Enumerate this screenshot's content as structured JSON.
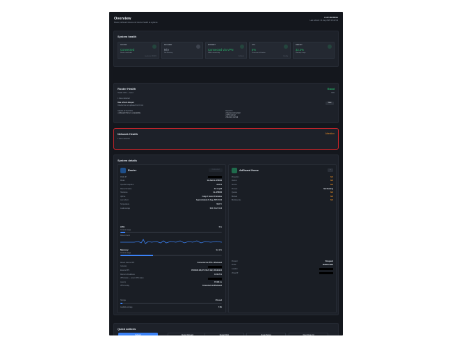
{
  "header": {
    "title": "Overview",
    "subtitle": "Router, AdGuard Home and internet health at a glance",
    "refresh_label": "LAST REFRESH",
    "refresh_time": "Last refresh: 21 Aug 2025 15:22:43"
  },
  "system_health": {
    "title": "System health",
    "tiles": [
      {
        "label": "ROUTER",
        "value": "Connected",
        "note": "Router reachable",
        "foot": "by device: WGWG",
        "color": "#29b86b",
        "icon": "router-icon"
      },
      {
        "label": "ADGUARD",
        "value": "N/A",
        "note": "Not Running",
        "foot": "",
        "color": "#a6b0bc",
        "icon": "shield-icon"
      },
      {
        "label": "INTERNET",
        "value": "Connected via VPN",
        "note": "WAN connectivity",
        "foot": "OutSmart",
        "color": "#29b86b",
        "icon": "globe-icon"
      },
      {
        "label": "CPU",
        "value": "5%",
        "note": "Processor utilization",
        "foot": "Healthy",
        "color": "#29b86b",
        "icon": "cpu-icon"
      },
      {
        "label": "MEMORY",
        "value": "32.2%",
        "note": "Memory usage",
        "foot": "",
        "color": "#29b86b",
        "icon": "memory-icon"
      }
    ]
  },
  "router_health": {
    "title": "Router Health",
    "subtitle": "Health: 93% — Good",
    "status": "Good",
    "score": "93%",
    "issues": "1 Issue detected",
    "stale_title": "Data refresh delayed",
    "stale_text": "Checks has not updated for 10 min",
    "view_label": "View",
    "attention_heading": "NEEDS ATTENTION",
    "attention_items": [
      "AdGuard Home is unavailable"
    ],
    "healthy_heading": "HEALTHY",
    "healthy_items": [
      "Internet connected",
      "CPU normal",
      "Memory normal"
    ]
  },
  "network_health": {
    "title": "Network Health",
    "status": "Attention",
    "issues": "1 Issue detected"
  },
  "system_details": {
    "title": "System details",
    "router": {
      "title": "Router",
      "button": "Connected",
      "rows": [
        {
          "k": "Public IP",
          "v": ""
        },
        {
          "k": "Model",
          "v": "GL-iNet GL-MT6000"
        },
        {
          "k": "OpenWrt snapshot",
          "v": "23.05.2"
        },
        {
          "k": "Router firmware",
          "v": "4.6.1-op23"
        },
        {
          "k": "Hostname",
          "v": "GL-MT6000"
        },
        {
          "k": "Uptime",
          "v": "4 days 1 hours 40 minutes"
        },
        {
          "k": "Last reboot",
          "v": "Approximately 21 Aug, 2025 15:22"
        },
        {
          "k": "Temperature",
          "v": "56.8 °C"
        },
        {
          "k": "Load average",
          "v": "0.01 / 0.12 / 0.12"
        }
      ],
      "cpu_label": "CPU",
      "cpu_value": "5%",
      "cpu_current": "Current usage",
      "cpu_recent": "Recent trend",
      "cpu_fill": 0.05,
      "mem_label": "Memory",
      "mem_value": "32.2%",
      "mem_current": "Current usage",
      "mem_fill": 0.322,
      "rows2": [
        {
          "k": "Recent Internet IPS",
          "v": "Connected via VPN + WireGuard"
        },
        {
          "k": "Gateway",
          "v": ""
        },
        {
          "k": "External IPS",
          "v": "IP 208.80.198, IP 2.59.27.182, 185.98.98.2"
        },
        {
          "k": "Router LAN address",
          "v": "10.59.75.1"
        },
        {
          "k": "VPN status — recent VPN status",
          "v": ""
        },
        {
          "k": "Latency",
          "v": "15.329 ms"
        },
        {
          "k": "VPN overlay",
          "v": "Connected via WireGuard"
        }
      ],
      "storage_label": "Storage",
      "storage_value": "2% used",
      "storage_fill": 0.02,
      "avail_label": "Available storage",
      "avail_value": "7.6G"
    },
    "adguard": {
      "title": "AdGuard Home",
      "button": "...",
      "rows": [
        {
          "k": "Protection",
          "v": "N/A"
        },
        {
          "k": "Version",
          "v": "N/A"
        },
        {
          "k": "Service",
          "v": "N/A"
        },
        {
          "k": "Process",
          "v": "Not Running"
        },
        {
          "k": "Queries",
          "v": "N/A"
        },
        {
          "k": "Blocked",
          "v": "N/A"
        },
        {
          "k": "Blocking rate",
          "v": "N/A"
        }
      ],
      "rows2": [
        {
          "k": "Protocol",
          "v": "Wireguard"
        },
        {
          "k": "Profile",
          "v": "WHHOG-WAD"
        },
        {
          "k": "Location",
          "v": ""
        },
        {
          "k": "Virtual IP",
          "v": ""
        }
      ]
    }
  },
  "quick_actions": {
    "title": "Quick actions",
    "buttons": [
      "Refresh",
      "Restart AdGuard",
      "Restart Wi-Fi",
      "Create Backup",
      "Open Router UI"
    ]
  },
  "colors": {
    "accent": "#3b82f6",
    "good": "#29b86b",
    "warn": "#e28a25",
    "alert_border": "#d2262b"
  }
}
